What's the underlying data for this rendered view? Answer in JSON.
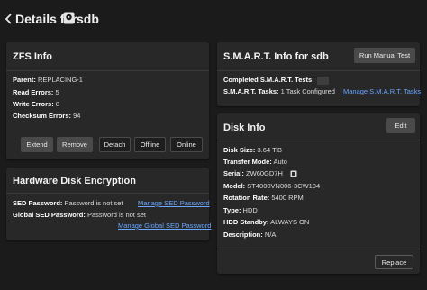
{
  "header": {
    "title": "Details for",
    "disk": "sdb"
  },
  "zfs_info": {
    "title": "ZFS Info",
    "parent_label": "Parent:",
    "parent_value": "REPLACING-1",
    "read_errors_label": "Read Errors:",
    "read_errors_value": "5",
    "write_errors_label": "Write Errors:",
    "write_errors_value": "8",
    "checksum_errors_label": "Checksum Errors:",
    "checksum_errors_value": "94",
    "buttons": {
      "extend": "Extend",
      "remove": "Remove",
      "detach": "Detach",
      "offline": "Offline",
      "online": "Online"
    }
  },
  "encryption": {
    "title": "Hardware Disk Encryption",
    "sed_password_label": "SED Password:",
    "sed_password_value": "Password is not set",
    "sed_password_link": "Manage SED Password",
    "global_sed_label": "Global SED Password:",
    "global_sed_value": "Password is not set",
    "global_sed_link": "Manage Global SED Password"
  },
  "smart": {
    "title": "S.M.A.R.T. Info for sdb",
    "run_button": "Run Manual Test",
    "completed_label": "Completed S.M.A.R.T. Tests:",
    "tasks_label": "S.M.A.R.T. Tasks:",
    "tasks_value": "1 Task Configured",
    "manage_link": "Manage S.M.A.R.T. Tasks"
  },
  "disk_info": {
    "title": "Disk Info",
    "edit_button": "Edit",
    "size_label": "Disk Size:",
    "size_value": "3.64 TiB",
    "transfer_label": "Transfer Mode:",
    "transfer_value": "Auto",
    "serial_label": "Serial:",
    "serial_value": "ZW60GD7H",
    "model_label": "Model:",
    "model_value": "ST4000VN006-3CW104",
    "rotation_label": "Rotation Rate:",
    "rotation_value": "5400 RPM",
    "type_label": "Type:",
    "type_value": "HDD",
    "standby_label": "HDD Standby:",
    "standby_value": "ALWAYS ON",
    "description_label": "Description:",
    "description_value": "N/A",
    "replace_button": "Replace"
  }
}
